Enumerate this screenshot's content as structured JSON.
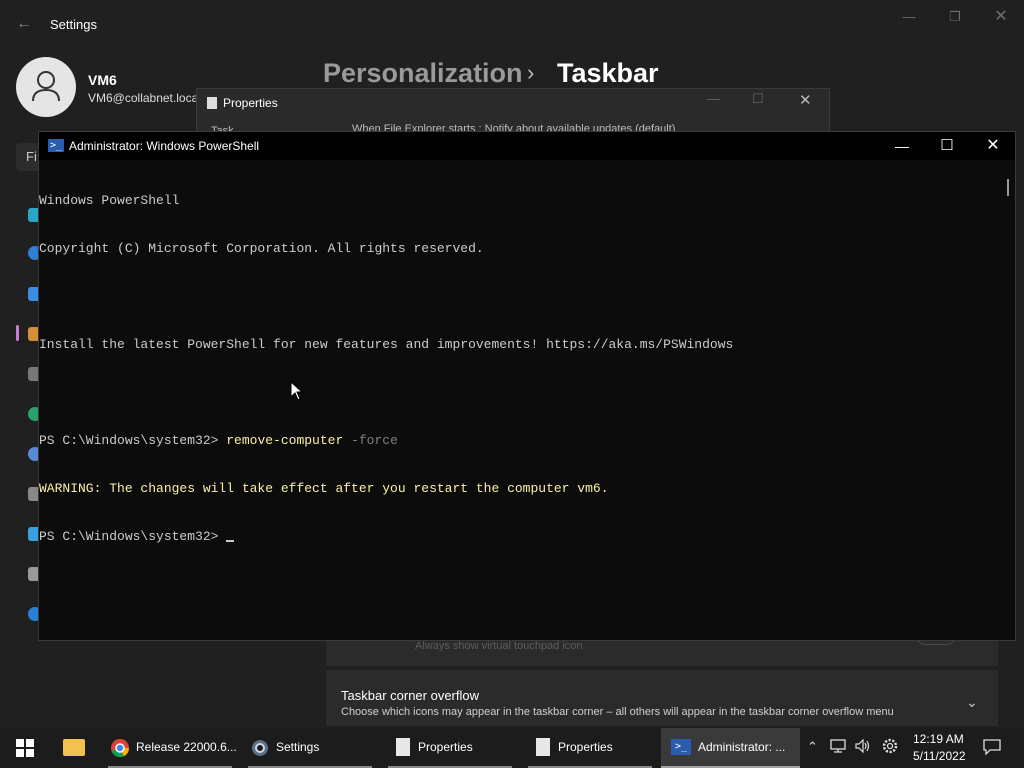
{
  "settings": {
    "app_title": "Settings",
    "user_name": "VM6",
    "user_email": "VM6@collabnet.local",
    "find_placeholder": "Fi",
    "breadcrumb_parent": "Personalization",
    "breadcrumb_separator": "›",
    "breadcrumb_current": "Taskbar",
    "faded_option": "Always show virtual touchpad icon",
    "overflow_card": {
      "title": "Taskbar corner overflow",
      "description": "Choose which icons may appear in the taskbar corner – all others will appear in the taskbar corner overflow menu"
    }
  },
  "properties_window": {
    "title": "Properties",
    "tab_partial": "Task",
    "text_partial": "When File Explorer starts : Notify about available updates (default)"
  },
  "powershell": {
    "title": "Administrator: Windows PowerShell",
    "lines": {
      "l1": "Windows PowerShell",
      "l2": "Copyright (C) Microsoft Corporation. All rights reserved.",
      "l3": "Install the latest PowerShell for new features and improvements! https://aka.ms/PSWindows",
      "prompt1": "PS C:\\Windows\\system32> ",
      "cmd1": "remove-computer",
      "param1": " -force",
      "warning": "WARNING: The changes will take effect after you restart the computer vm6.",
      "prompt2": "PS C:\\Windows\\system32> "
    }
  },
  "taskbar": {
    "chrome_label": "Release 22000.6...",
    "settings_label": "Settings",
    "props1_label": "Properties",
    "props2_label": "Properties",
    "ps_label": "Administrator: ...",
    "time": "12:19 AM",
    "date": "5/11/2022"
  },
  "icons": [
    "start-icon",
    "file-explorer-icon",
    "chrome-icon",
    "settings-gear-icon",
    "properties-icon",
    "powershell-icon",
    "chevron-up-icon",
    "network-icon",
    "volume-icon",
    "gear-icon",
    "notification-icon"
  ],
  "colors": {
    "accent": "#c67ecf",
    "ps_background": "#0c0c0c",
    "ps_warning": "#f9f1a5",
    "ps_text": "#cccccc"
  }
}
